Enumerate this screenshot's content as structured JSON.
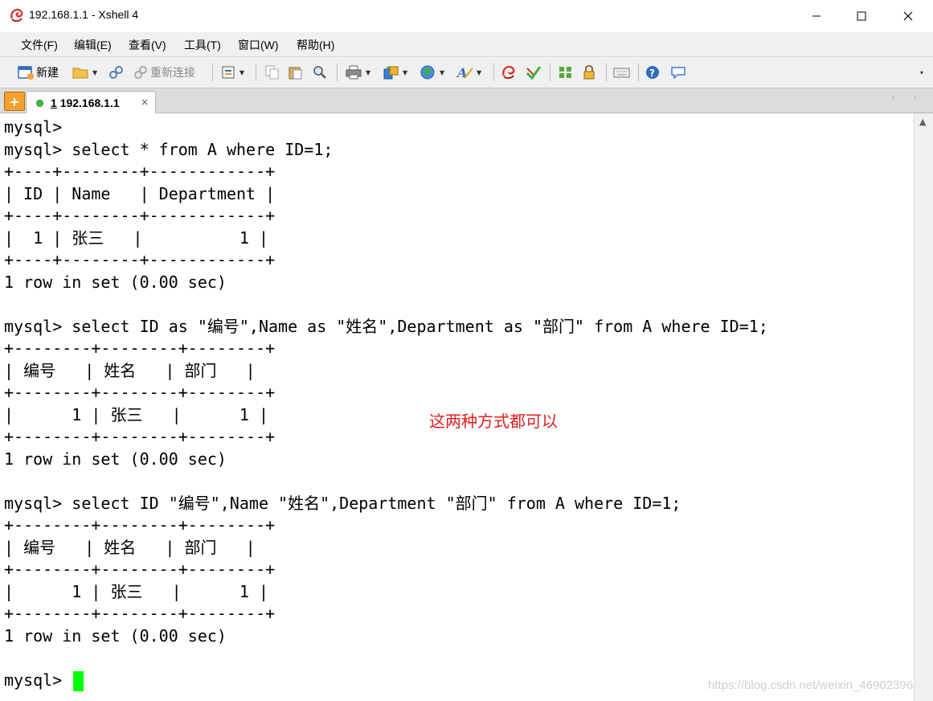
{
  "window": {
    "title": "192.168.1.1 - Xshell 4"
  },
  "menu": [
    "文件(F)",
    "编辑(E)",
    "查看(V)",
    "工具(T)",
    "窗口(W)",
    "帮助(H)"
  ],
  "toolbar": {
    "new_label": "新建",
    "reconnect_label": "重新连接"
  },
  "tab": {
    "number": "1",
    "label": "192.168.1.1",
    "close": "×"
  },
  "terminal": {
    "lines": [
      "mysql>",
      "mysql> select * from A where ID=1;",
      "+----+--------+------------+",
      "| ID | Name   | Department |",
      "+----+--------+------------+",
      "|  1 | 张三   |          1 |",
      "+----+--------+------------+",
      "1 row in set (0.00 sec)",
      "",
      "mysql> select ID as \"编号\",Name as \"姓名\",Department as \"部门\" from A where ID=1;",
      "+--------+--------+--------+",
      "| 编号   | 姓名   | 部门   |",
      "+--------+--------+--------+",
      "|      1 | 张三   |      1 |",
      "+--------+--------+--------+",
      "1 row in set (0.00 sec)",
      "",
      "mysql> select ID \"编号\",Name \"姓名\",Department \"部门\" from A where ID=1;",
      "+--------+--------+--------+",
      "| 编号   | 姓名   | 部门   |",
      "+--------+--------+--------+",
      "|      1 | 张三   |      1 |",
      "+--------+--------+--------+",
      "1 row in set (0.00 sec)",
      ""
    ],
    "prompt": "mysql> "
  },
  "annotation": "这两种方式都可以",
  "watermark": "https://blog.csdn.net/weixin_46902396",
  "colors": {
    "cursor": "#00ff00",
    "annotation": "#e02020"
  }
}
